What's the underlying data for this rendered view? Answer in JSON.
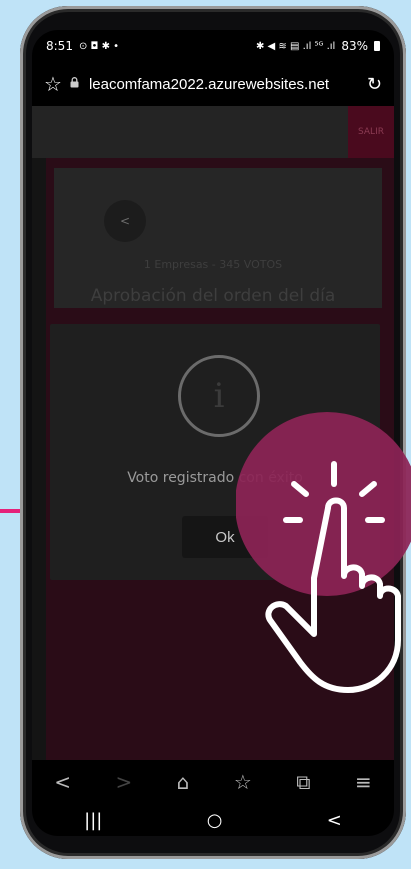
{
  "status_bar": {
    "time": "8:51",
    "left_icons": "⊙ ◘ ✱ •",
    "right_icons": "✱ ◀ ≋ ▤ .ıl ⁵ᴳ .ıl",
    "battery": "83%"
  },
  "browser": {
    "url": "leacomfama2022.azurewebsites.net",
    "star_icon": "☆",
    "lock_icon": "🔒",
    "refresh_icon": "↻"
  },
  "page": {
    "salir_label": "SALIR",
    "back_glyph": "<",
    "votes_line": "1 Empresas - 345 VOTOS",
    "agenda_title": "Aprobación del orden del día"
  },
  "modal": {
    "info_glyph": "i",
    "message": "Voto registrado con éxito",
    "ok_label": "Ok"
  },
  "browser_nav": {
    "back": "<",
    "forward": ">",
    "home": "⌂",
    "bookmark": "☆",
    "tabs": "⧉",
    "menu": "≡"
  },
  "system_nav": {
    "recents": "|||",
    "home": "○",
    "back": "<"
  },
  "colors": {
    "background": "#bfe3f7",
    "accent_pink": "#e5227a",
    "tap_circle": "#8c2455"
  }
}
